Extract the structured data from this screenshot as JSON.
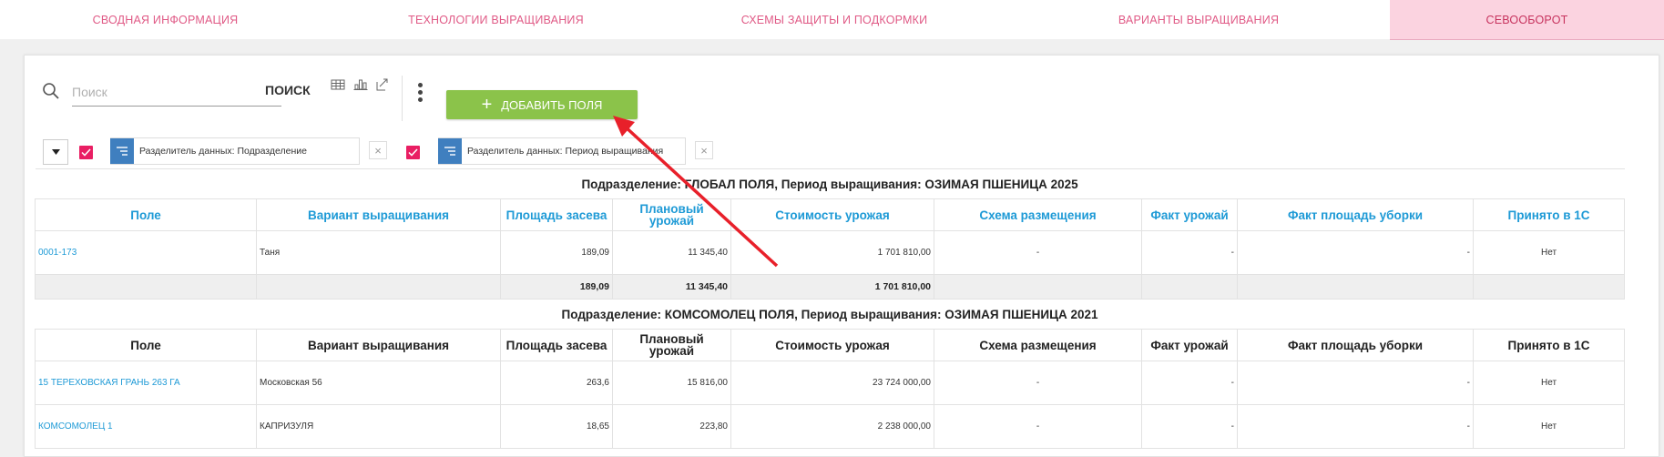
{
  "tabs": [
    {
      "label": "СВОДНАЯ ИНФОРМАЦИЯ"
    },
    {
      "label": "ТЕХНОЛОГИИ ВЫРАЩИВАНИЯ"
    },
    {
      "label": "СХЕМЫ ЗАЩИТЫ И ПОДКОРМКИ"
    },
    {
      "label": "ВАРИАНТЫ ВЫРАЩИВАНИЯ"
    },
    {
      "label": "СЕВООБОРОТ",
      "active": true
    }
  ],
  "toolbar": {
    "search_placeholder": "Поиск",
    "search_value": "",
    "search_button": "ПОИСК",
    "add_button": "ДОБАВИТЬ ПОЛЯ",
    "view_icons": [
      "table-view-icon",
      "chart-view-icon",
      "export-icon"
    ]
  },
  "filters": [
    {
      "label": "Разделитель данных: Подразделение",
      "checked": true
    },
    {
      "label": "Разделитель данных: Период выращивания",
      "checked": true
    }
  ],
  "columns": [
    "Поле",
    "Вариант выращивания",
    "Площадь засева",
    "Плановый урожай",
    "Стоимость урожая",
    "Схема размещения",
    "Факт урожай",
    "Факт площадь уборки",
    "Принято в 1С"
  ],
  "groups": [
    {
      "title": "Подразделение: ГЛОБАЛ ПОЛЯ, Период выращивания: ОЗИМАЯ ПШЕНИЦА 2025",
      "rows": [
        {
          "field": "0001-173",
          "variant": "Таня",
          "area": "189,09",
          "plan": "11 345,40",
          "cost": "1 701 810,00",
          "scheme": "-",
          "fact_yield": "-",
          "fact_area": "-",
          "accepted": "Нет"
        }
      ],
      "totals": {
        "area": "189,09",
        "plan": "11 345,40",
        "cost": "1 701 810,00"
      }
    },
    {
      "title": "Подразделение: КОМСОМОЛЕЦ ПОЛЯ, Период выращивания: ОЗИМАЯ ПШЕНИЦА 2021",
      "rows": [
        {
          "field": "15 ТЕРЕХОВСКАЯ ГРАНЬ 263 ГА",
          "variant": "Московская 56",
          "area": "263,6",
          "plan": "15 816,00",
          "cost": "23 724 000,00",
          "scheme": "-",
          "fact_yield": "-",
          "fact_area": "-",
          "accepted": "Нет"
        },
        {
          "field": "КОМСОМОЛЕЦ 1",
          "variant": "КАПРИЗУЛЯ",
          "area": "18,65",
          "plan": "223,80",
          "cost": "2 238 000,00",
          "scheme": "-",
          "fact_yield": "-",
          "fact_area": "-",
          "accepted": "Нет"
        }
      ]
    }
  ],
  "colors": {
    "accent_pink": "#e05a86",
    "active_tab_bg": "#fbd3e0",
    "add_green": "#8bc34a",
    "link_blue": "#1e9ad6",
    "badge_blue": "#3f7fbf",
    "checkbox_pink": "#e91e63",
    "annotation_arrow": "#e8202a"
  }
}
